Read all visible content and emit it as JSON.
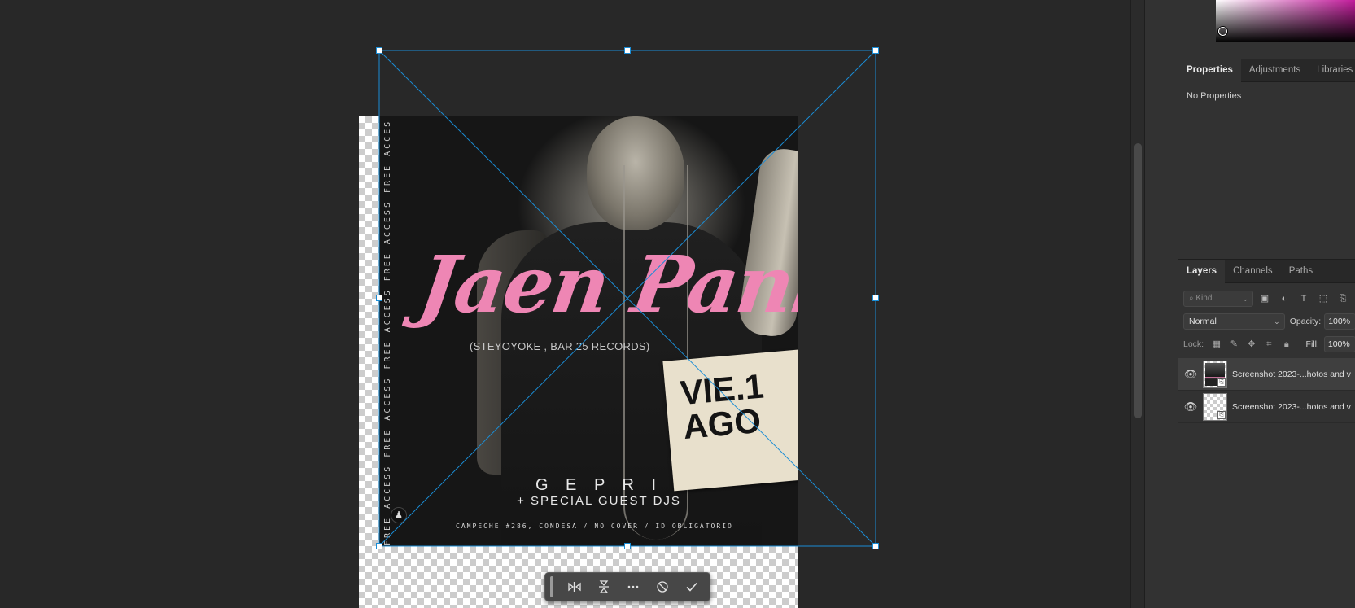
{
  "poster": {
    "vertical_text": "FREE ACCESS   FREE ACCESS   FREE ACCESS   FREE ACCESS   FREE ACCESS   FREE ACCESS   FREE ACC",
    "script_title": "Jaen Paniagu",
    "record_line": "(STEYOYOKE , BAR 25 RECORDS)",
    "date_line1": "VIE.1",
    "date_line2": "AGO",
    "headliner": "G E P R I",
    "guests": "+ SPECIAL GUEST DJS",
    "address": "CAMPECHE #286, CONDESA / NO COVER  /  ID OBLIGATORIO"
  },
  "taskbar": {
    "buttons": [
      "flip-horizontal-icon",
      "flip-vertical-icon",
      "more-icon",
      "cancel-icon",
      "commit-icon"
    ]
  },
  "properties_panel": {
    "tabs": [
      "Properties",
      "Adjustments",
      "Libraries"
    ],
    "active_tab": "Properties",
    "content": "No Properties"
  },
  "layers_panel": {
    "tabs": [
      "Layers",
      "Channels",
      "Paths"
    ],
    "active_tab": "Layers",
    "filter_placeholder": "Kind",
    "blend_mode": "Normal",
    "opacity_label": "Opacity:",
    "opacity": "100%",
    "lock_label": "Lock:",
    "fill_label": "Fill:",
    "fill": "100%",
    "layers": [
      {
        "name": "Screenshot 2023-...hotos and v",
        "visible": true,
        "selected": true
      },
      {
        "name": "Screenshot 2023-...hotos and v",
        "visible": true,
        "selected": false
      }
    ]
  },
  "colors": {
    "accent_handles": "#1a8dd6",
    "pink_script": "#ee86b4",
    "canvas_bg": "#282828",
    "panel_bg": "#323232"
  }
}
